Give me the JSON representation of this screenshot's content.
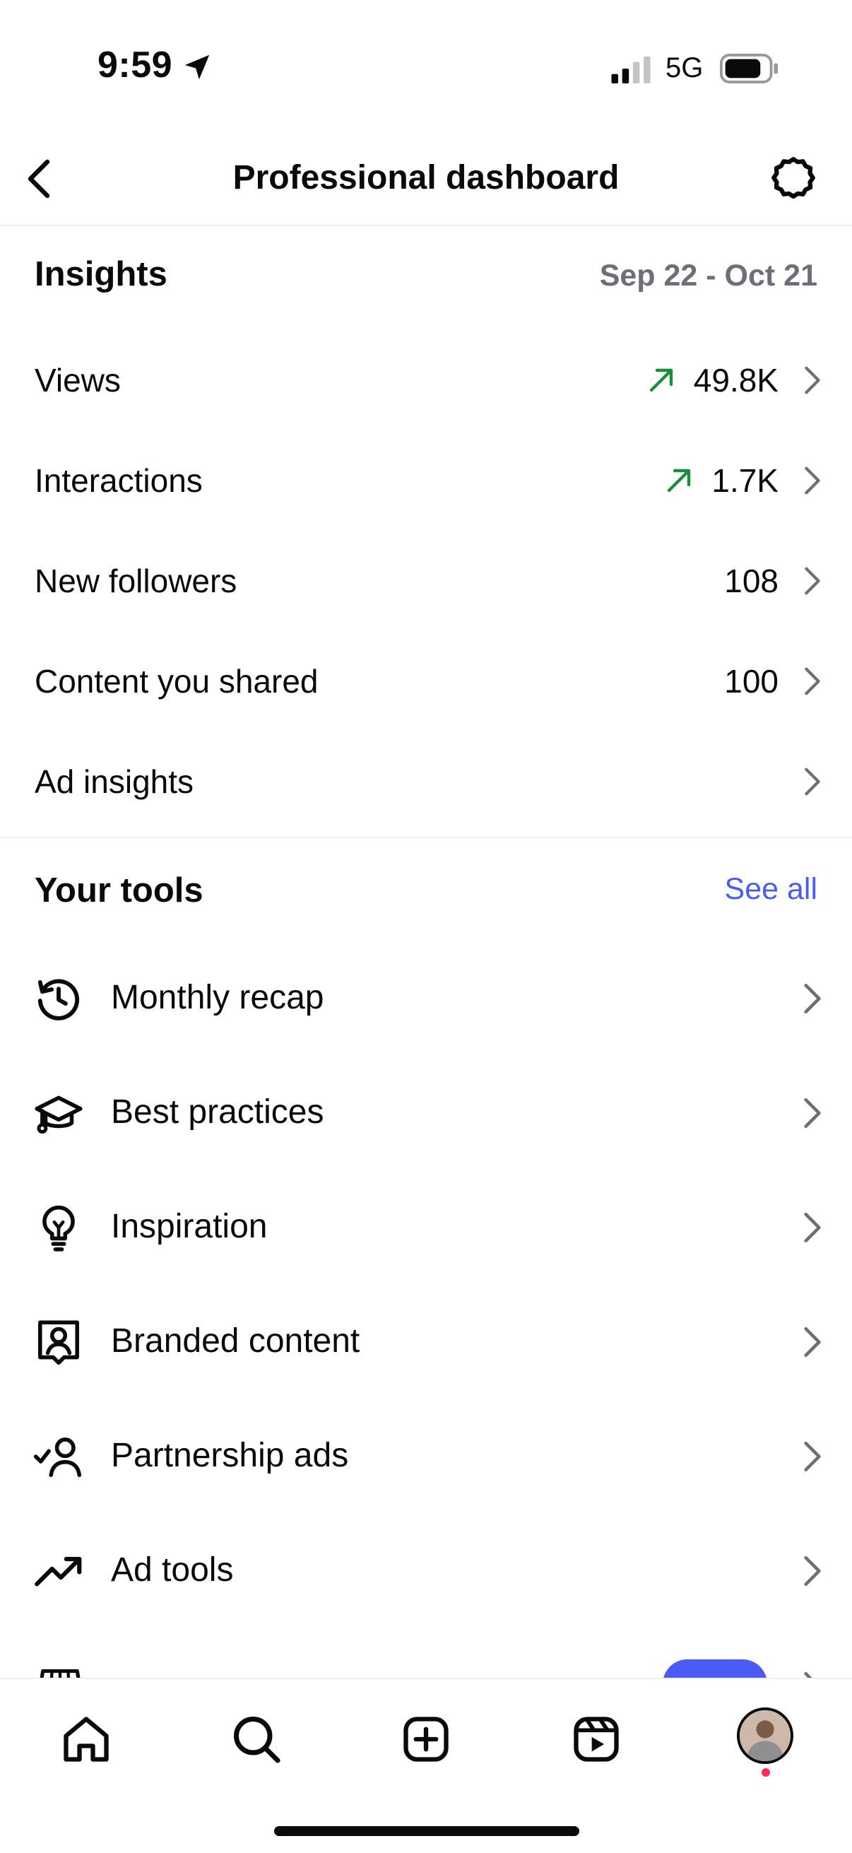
{
  "status_bar": {
    "time": "9:59",
    "network": "5G"
  },
  "header": {
    "title": "Professional dashboard"
  },
  "insights": {
    "title": "Insights",
    "date_range": "Sep 22 - Oct 21",
    "metrics": [
      {
        "label": "Views",
        "value": "49.8K",
        "trend": "up"
      },
      {
        "label": "Interactions",
        "value": "1.7K",
        "trend": "up"
      },
      {
        "label": "New followers",
        "value": "108"
      },
      {
        "label": "Content you shared",
        "value": "100"
      },
      {
        "label": "Ad insights",
        "value": ""
      }
    ]
  },
  "tools": {
    "title": "Your tools",
    "see_all": "See all",
    "items": [
      {
        "label": "Monthly recap",
        "icon": "history-icon"
      },
      {
        "label": "Best practices",
        "icon": "graduation-cap-icon"
      },
      {
        "label": "Inspiration",
        "icon": "lightbulb-icon"
      },
      {
        "label": "Branded content",
        "icon": "branded-content-icon"
      },
      {
        "label": "Partnership ads",
        "icon": "partnership-icon"
      },
      {
        "label": "Ad tools",
        "icon": "trending-up-icon"
      }
    ]
  },
  "colors": {
    "accent": "#4a5cf5",
    "trend_up": "#1a8d3b",
    "muted": "#6c6f77",
    "notification": "#ff2d55"
  },
  "bottom_nav": {
    "items": [
      "home-icon",
      "search-icon",
      "create-icon",
      "reels-icon",
      "profile-avatar"
    ]
  }
}
